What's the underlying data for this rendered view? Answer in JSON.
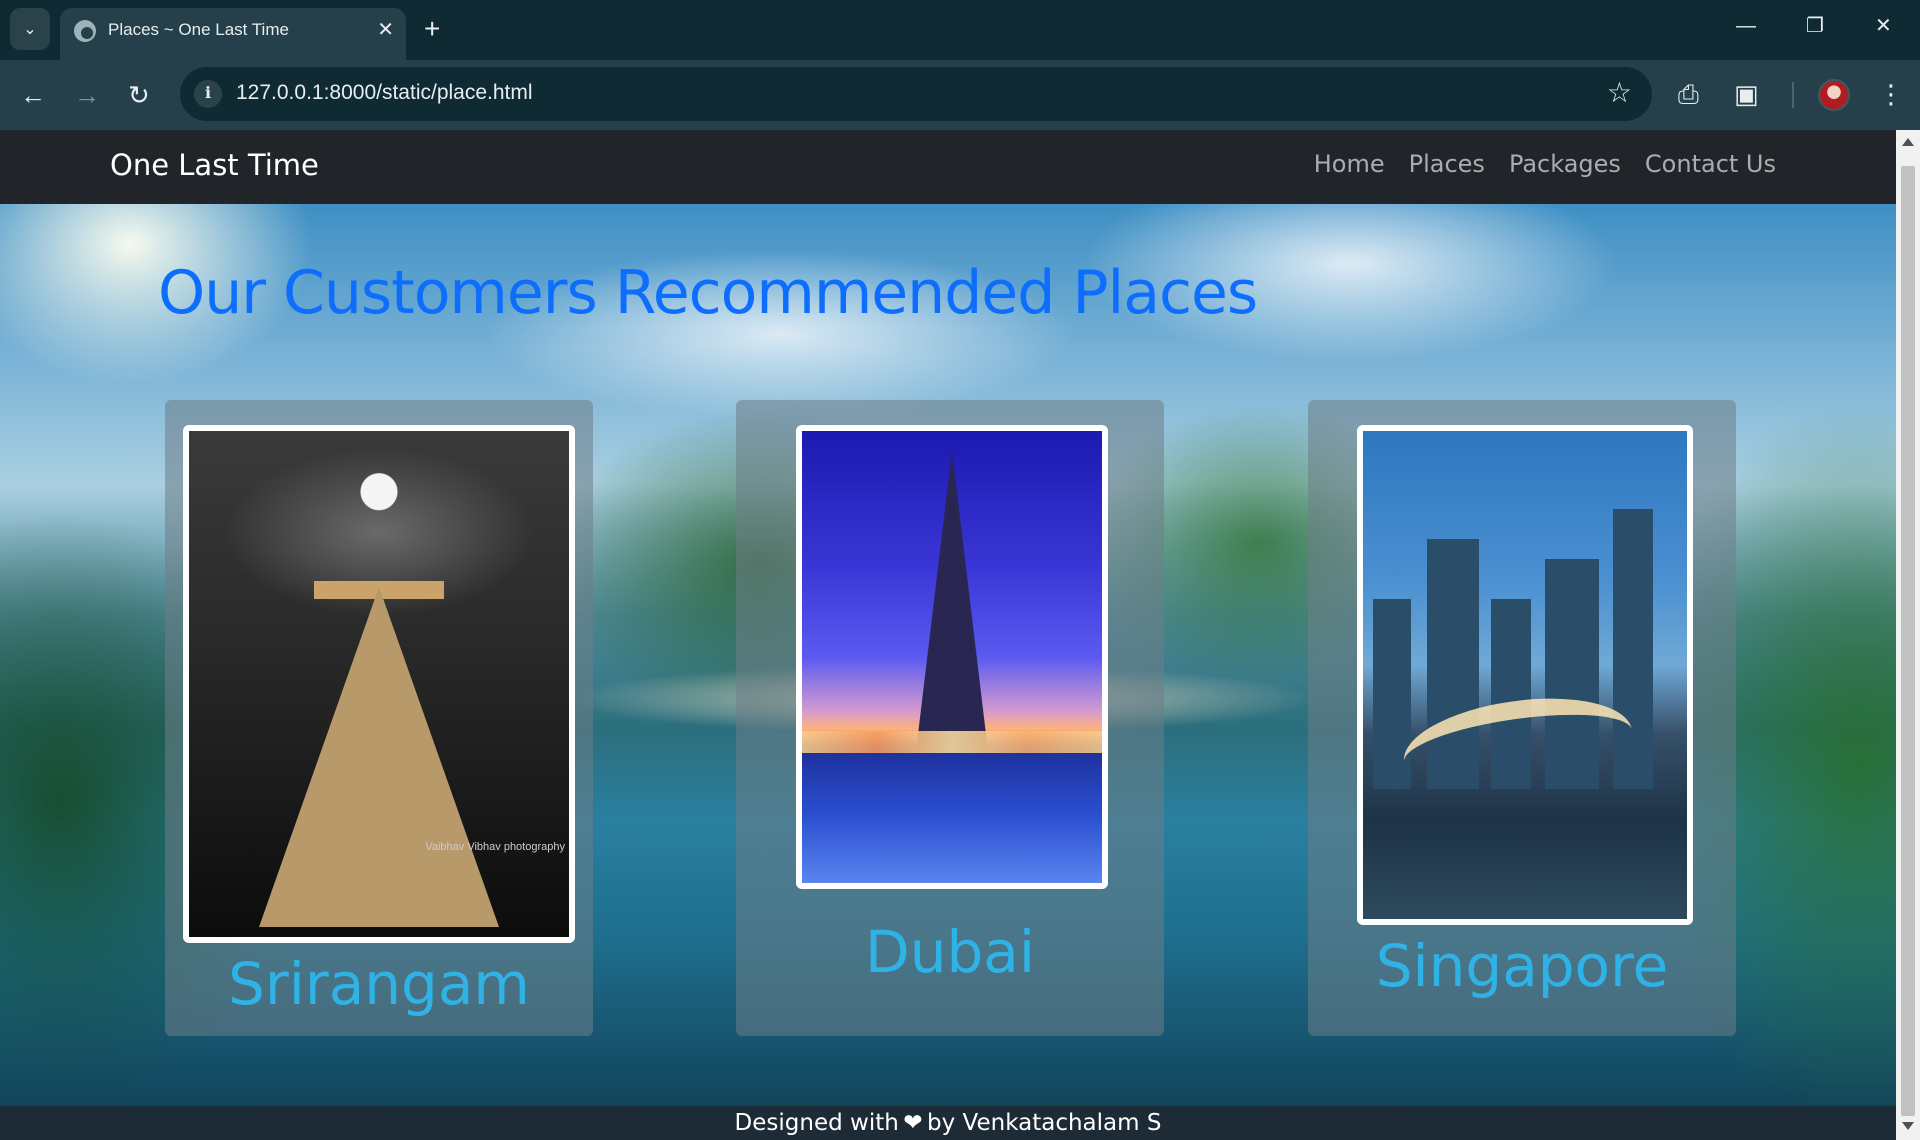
{
  "browser": {
    "tab_title": "Places ~ One Last Time",
    "url": "127.0.0.1:8000/static/place.html"
  },
  "navbar": {
    "brand": "One Last Time",
    "links": [
      "Home",
      "Places",
      "Packages",
      "Contact Us"
    ]
  },
  "main": {
    "heading": "Our Customers Recommended Places",
    "cards": [
      {
        "name": "Srirangam",
        "photo_caption": "Vaibhav Vibhav photography"
      },
      {
        "name": "Dubai"
      },
      {
        "name": "Singapore"
      }
    ]
  },
  "footer": {
    "prefix": "Designed with",
    "heart": "❤",
    "suffix": "by Venkatachalam S"
  },
  "colors": {
    "heading": "#0d6efd",
    "card_label": "#2fb3e6",
    "navbar_bg": "#212529"
  }
}
